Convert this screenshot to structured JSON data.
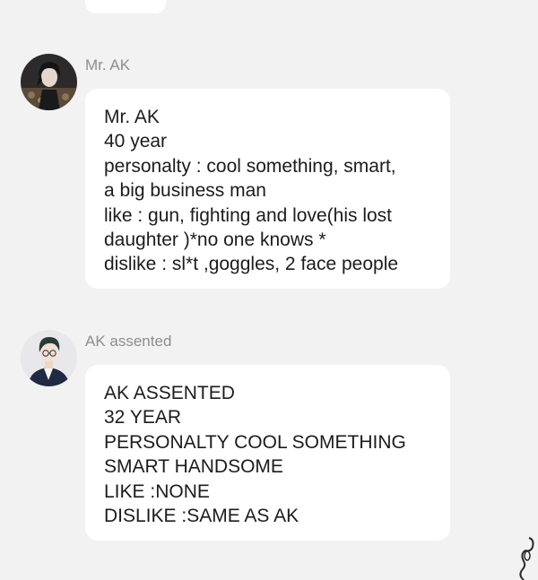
{
  "messages": [
    {
      "sender": "Mr. AK",
      "avatar": "dark-haired-man-avatar",
      "lines": [
        "Mr. AK",
        "40 year",
        "personalty : cool something, smart,",
        "a big business man",
        "like : gun, fighting and love(his  lost",
        "daughter )*no one knows *",
        "dislike : sl*t ,goggles, 2 face people"
      ]
    },
    {
      "sender": "AK assented",
      "avatar": "man-with-glasses-avatar",
      "lines": [
        "AK ASSENTED",
        "32 YEAR",
        "PERSONALTY COOL SOMETHING",
        "SMART HANDSOME",
        "LIKE :NONE",
        "DISLIKE :SAME AS AK"
      ]
    }
  ],
  "colors": {
    "background": "#f2f2f2",
    "bubble": "#ffffff",
    "sender_text": "#8d8d8d",
    "message_text": "#1c1c1c"
  }
}
